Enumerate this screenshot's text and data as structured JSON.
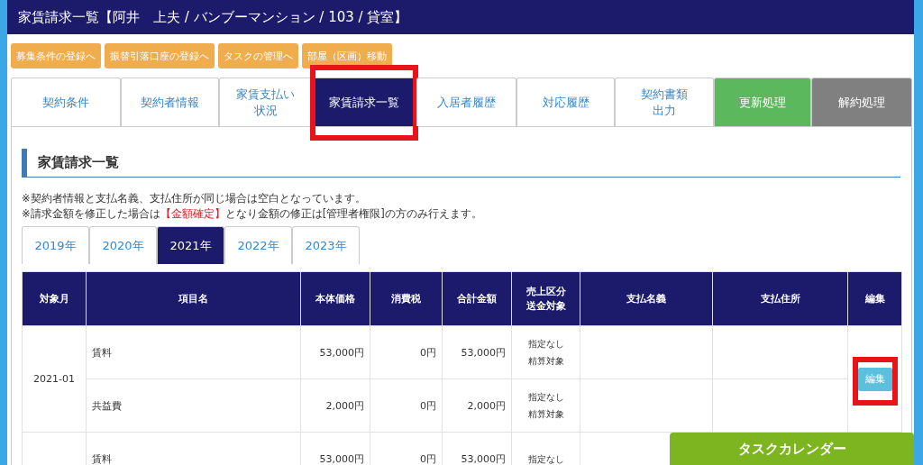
{
  "header": {
    "title": "家賃請求一覧【阿井　上夫 / バンブーマンション / 103 / 貸室】"
  },
  "action_buttons": [
    "募集条件の登録へ",
    "振替引落口座の登録へ",
    "タスクの管理へ",
    "部屋（区画）移動"
  ],
  "tabs": [
    {
      "lines": [
        "契約条件"
      ],
      "kind": "normal",
      "selected": false,
      "highlighted": false
    },
    {
      "lines": [
        "契約者情報"
      ],
      "kind": "normal",
      "selected": false,
      "highlighted": false
    },
    {
      "lines": [
        "家賃支払い",
        "状況"
      ],
      "kind": "normal",
      "selected": false,
      "highlighted": false
    },
    {
      "lines": [
        "家賃請求一覧"
      ],
      "kind": "normal",
      "selected": true,
      "highlighted": true
    },
    {
      "lines": [
        "入居者履歴"
      ],
      "kind": "normal",
      "selected": false,
      "highlighted": false
    },
    {
      "lines": [
        "対応履歴"
      ],
      "kind": "normal",
      "selected": false,
      "highlighted": false
    },
    {
      "lines": [
        "契約書類",
        "出力"
      ],
      "kind": "normal",
      "selected": false,
      "highlighted": false
    },
    {
      "lines": [
        "更新処理"
      ],
      "kind": "renew",
      "selected": false,
      "highlighted": false
    },
    {
      "lines": [
        "解約処理"
      ],
      "kind": "cancel",
      "selected": false,
      "highlighted": false
    }
  ],
  "section": {
    "title": "家賃請求一覧",
    "notes": [
      [
        {
          "text": "※契約者情報と支払名義、支払住所が同じ場合は空白となっています。",
          "emphasis": false
        }
      ],
      [
        {
          "text": "※請求金額を修正した場合は",
          "emphasis": false
        },
        {
          "text": "【金額確定】",
          "emphasis": true
        },
        {
          "text": "となり金額の修正は[管理者権限]の方のみ行えます。",
          "emphasis": false
        }
      ]
    ]
  },
  "year_tabs": [
    {
      "label": "2019年",
      "selected": false
    },
    {
      "label": "2020年",
      "selected": false
    },
    {
      "label": "2021年",
      "selected": true
    },
    {
      "label": "2022年",
      "selected": false
    },
    {
      "label": "2023年",
      "selected": false
    }
  ],
  "table": {
    "columns": [
      [
        "対象月"
      ],
      [
        "項目名"
      ],
      [
        "本体価格"
      ],
      [
        "消費税"
      ],
      [
        "合計金額"
      ],
      [
        "売上区分",
        "送金対象"
      ],
      [
        "支払名義"
      ],
      [
        "支払住所"
      ],
      [
        "編集"
      ]
    ],
    "groups": [
      {
        "month": "2021-01",
        "edit_button": "編集",
        "edit_highlighted": true,
        "items": [
          {
            "name": "賃料",
            "price": "53,000円",
            "tax": "0円",
            "total": "53,000円",
            "category": [
              "指定なし",
              "精算対象"
            ]
          },
          {
            "name": "共益費",
            "price": "2,000円",
            "tax": "0円",
            "total": "2,000円",
            "category": [
              "指定なし",
              "精算対象"
            ]
          }
        ]
      },
      {
        "items": [
          {
            "name": "賃料",
            "price": "53,000円",
            "tax": "0円",
            "total": "53,000円",
            "category": [
              "指定なし"
            ]
          }
        ]
      }
    ]
  },
  "floating_button": "タスクカレンダー"
}
